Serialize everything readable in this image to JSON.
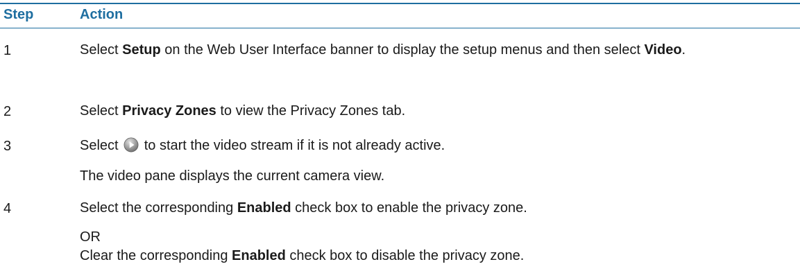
{
  "header": {
    "step": "Step",
    "action": "Action"
  },
  "steps": [
    {
      "num": "1",
      "a": "Select ",
      "b": "Setup",
      "c": " on the Web User Interface banner to display the setup menus and then select ",
      "d": "Video",
      "e": "."
    },
    {
      "num": "2",
      "a": "Select ",
      "b": "Privacy Zones",
      "c": " to view the Privacy Zones tab."
    },
    {
      "num": "3",
      "a": "Select ",
      "icon": "play-button-icon",
      "c": " to start the video stream if it is not already active.",
      "note": "The video pane displays the current camera view."
    },
    {
      "num": "4",
      "a": "Select the corresponding ",
      "b": "Enabled",
      "c": " check box to enable the privacy zone.",
      "or": "OR",
      "d": "Clear the corresponding ",
      "e": "Enabled",
      "f": " check box to disable the privacy zone."
    }
  ],
  "colors": {
    "accent": "#1e6ea0",
    "text": "#1a1a1a"
  }
}
